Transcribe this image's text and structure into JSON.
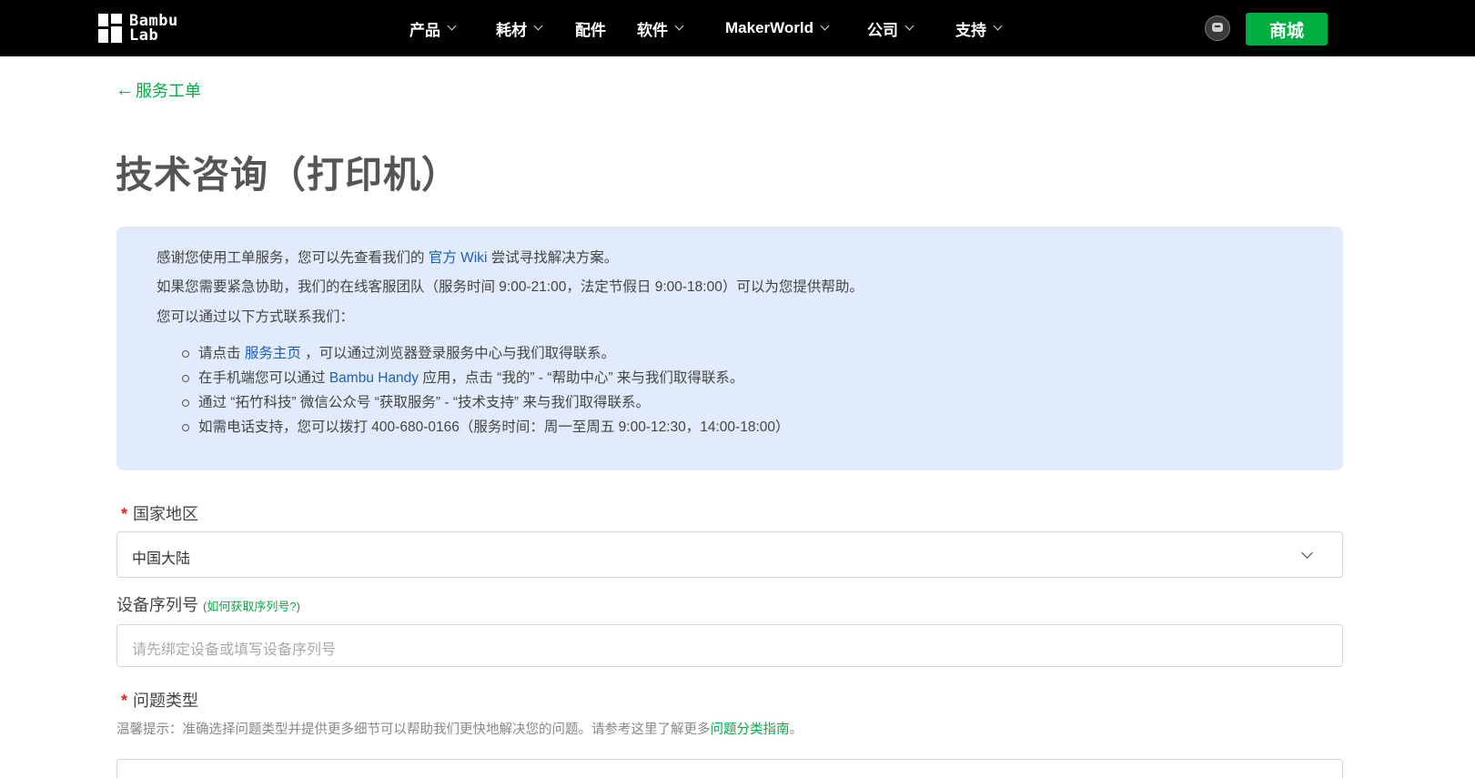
{
  "header": {
    "logo_line1": "Bambu",
    "logo_line2": "Lab",
    "nav": [
      "产品",
      "耗材",
      "配件",
      "软件",
      "MakerWorld",
      "公司",
      "支持"
    ],
    "shop_label": "商城",
    "brand_color": "#00ae42"
  },
  "back_link": {
    "arrow": "←",
    "label": "服务工单"
  },
  "page_title": "技术咨询（打印机）",
  "info": {
    "line1_pre": "感谢您使用工单服务，您可以先查看我们的",
    "line1_link": "官方 Wiki",
    "line1_post": "尝试寻找解决方案。",
    "line2": "如果您需要紧急协助，我们的在线客服团队（服务时间 9:00-21:00，法定节假日 9:00-18:00）可以为您提供帮助。",
    "line3": "您可以通过以下方式联系我们：",
    "item1_pre": "请点击",
    "item1_link": "服务主页",
    "item1_post": "，可以通过浏览器登录服务中心与我们取得联系。",
    "item2_pre": "在手机端您可以通过",
    "item2_link": "Bambu Handy",
    "item2_post": "应用，点击 “我的” - “帮助中心” 来与我们取得联系。",
    "item3": "通过 “拓竹科技” 微信公众号 “获取服务” - “技术支持” 来与我们取得联系。",
    "item4": "如需电话支持，您可以拨打 400-680-0166（服务时间：周一至周五 9:00-12:30，14:00-18:00）"
  },
  "form": {
    "required_mark": "*",
    "region_label": "国家地区",
    "region_value": "中国大陆",
    "serial_label": "设备序列号",
    "serial_help_open": "(",
    "serial_help_link": "如何获取序列号?",
    "serial_help_close": ")",
    "serial_placeholder": "请先绑定设备或填写设备序列号",
    "issue_label": "问题类型",
    "issue_hint_pre": "温馨提示：准确选择问题类型并提供更多细节可以帮助我们更快地解决您的问题。请参考这里了解更多",
    "issue_hint_link": "问题分类指南",
    "issue_hint_post": "。"
  }
}
